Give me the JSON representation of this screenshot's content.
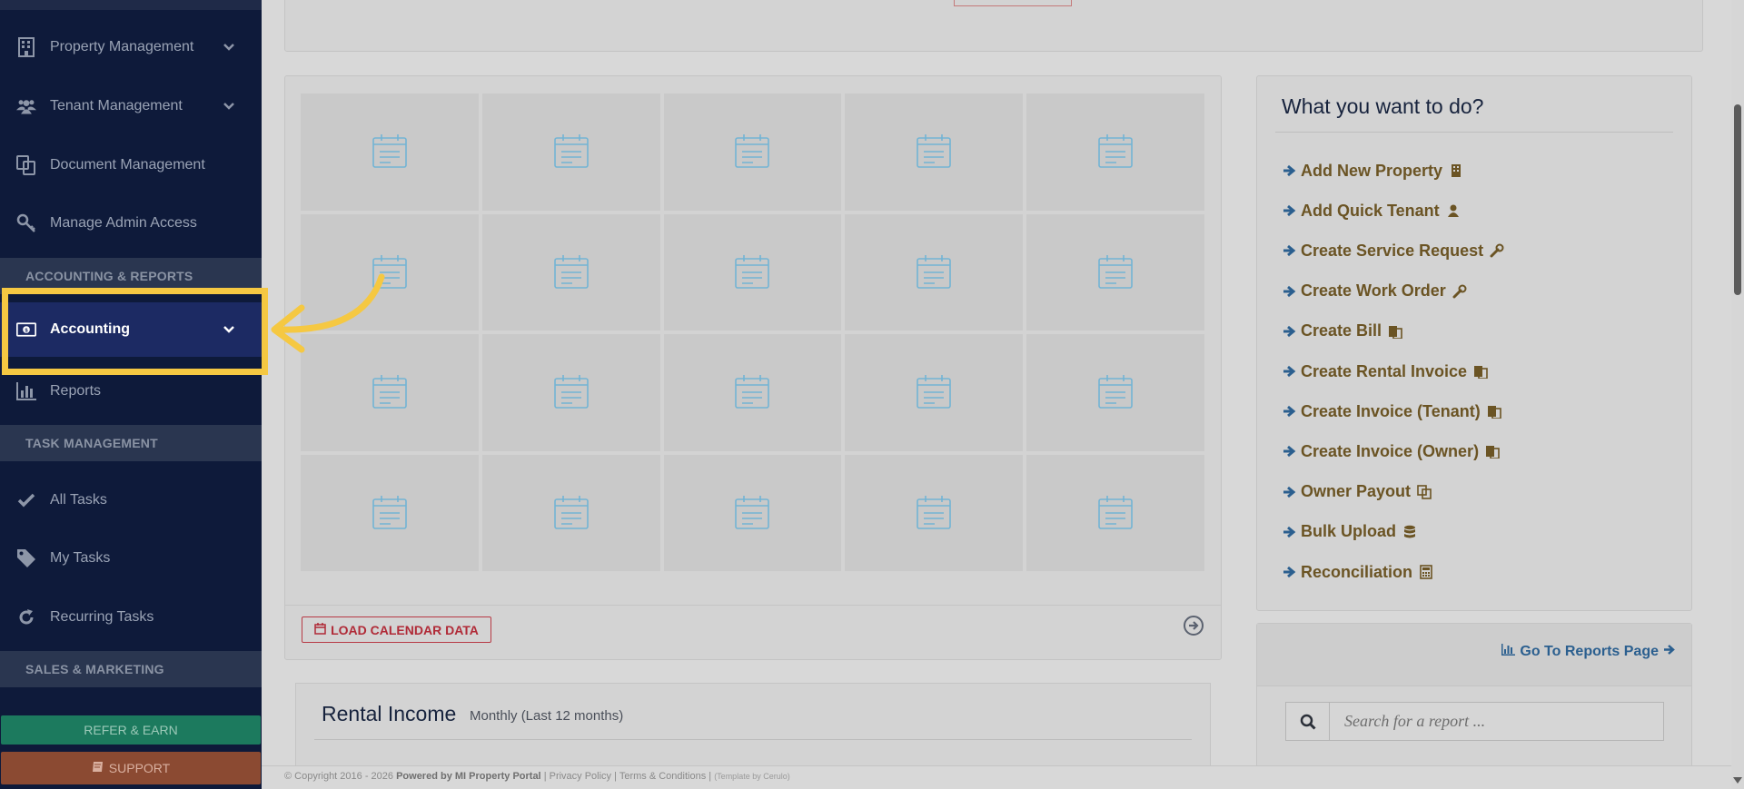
{
  "sidebar": {
    "items": [
      {
        "label": "Property Management",
        "icon": "building-icon",
        "has_chevron": true
      },
      {
        "label": "Tenant Management",
        "icon": "users-icon",
        "has_chevron": true
      },
      {
        "label": "Document Management",
        "icon": "copy-icon",
        "has_chevron": false
      },
      {
        "label": "Manage Admin Access",
        "icon": "key-icon",
        "has_chevron": false
      }
    ],
    "section_accounting": "ACCOUNTING & REPORTS",
    "accounting_label": "Accounting",
    "reports_label": "Reports",
    "section_tasks": "TASK MANAGEMENT",
    "tasks": [
      {
        "label": "All Tasks",
        "icon": "check-icon"
      },
      {
        "label": "My Tasks",
        "icon": "tag-icon"
      },
      {
        "label": "Recurring Tasks",
        "icon": "refresh-icon"
      }
    ],
    "section_sales": "SALES & MARKETING",
    "refer_label": "REFER & EARN",
    "support_label": "SUPPORT"
  },
  "calendar": {
    "load_button": "LOAD CALENDAR DATA"
  },
  "income": {
    "title": "Rental Income",
    "subtitle": "Monthly (Last 12 months)"
  },
  "todo": {
    "title": "What you want to do?",
    "links": [
      {
        "label": "Add New Property",
        "icon": "building-icon"
      },
      {
        "label": "Add Quick Tenant",
        "icon": "user-icon"
      },
      {
        "label": "Create Service Request",
        "icon": "wrench-icon"
      },
      {
        "label": "Create Work Order",
        "icon": "wrench-icon"
      },
      {
        "label": "Create Bill",
        "icon": "paste-icon"
      },
      {
        "label": "Create Rental Invoice",
        "icon": "paste-icon"
      },
      {
        "label": "Create Invoice (Tenant)",
        "icon": "paste-icon"
      },
      {
        "label": "Create Invoice (Owner)",
        "icon": "paste-icon"
      },
      {
        "label": "Owner Payout",
        "icon": "copy-icon"
      },
      {
        "label": "Bulk Upload",
        "icon": "database-icon"
      },
      {
        "label": "Reconciliation",
        "icon": "calculator-icon"
      }
    ]
  },
  "reports": {
    "go_label": "Go To Reports Page",
    "search_placeholder": "Search for a report ..."
  },
  "footer": {
    "copyright": "© Copyright 2016 - 2026",
    "powered": "Powered by MI Property Portal",
    "links": "| Privacy Policy | Terms & Conditions |",
    "template": "(Template by Cerulo)"
  },
  "colors": {
    "sidebar_bg": "#0e1a3a",
    "active_item": "#1c2a63",
    "highlight": "#f5c842",
    "link_text": "#6b5424",
    "arrow_blue": "#2b5f8f",
    "danger": "#b02a37"
  }
}
